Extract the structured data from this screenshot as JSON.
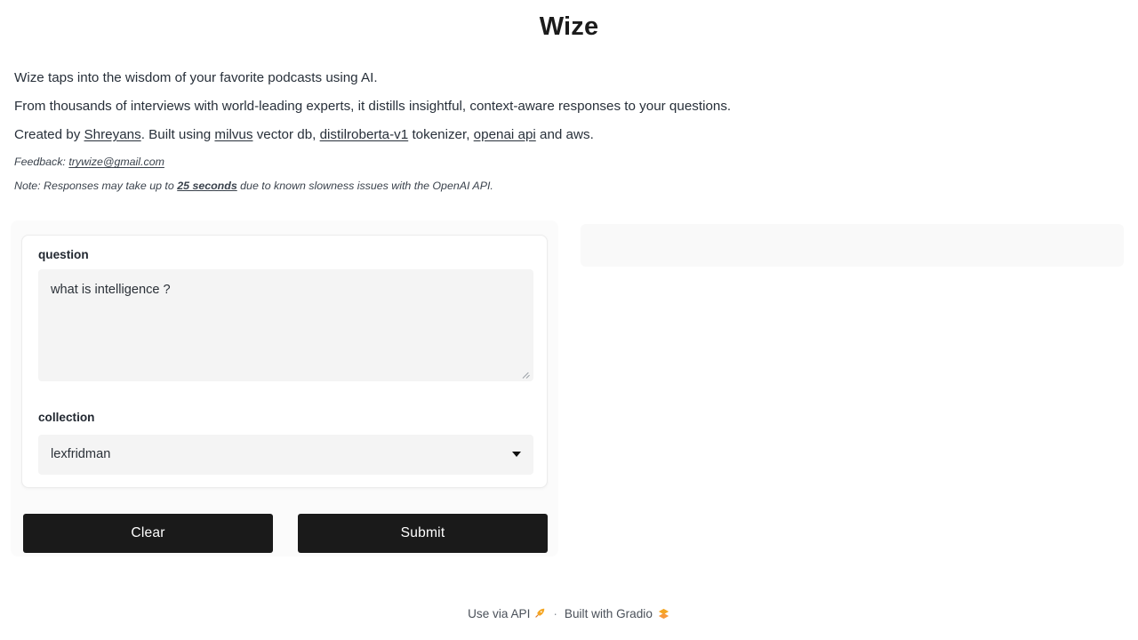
{
  "app": {
    "title": "Wize"
  },
  "description": {
    "line1": "Wize taps into the wisdom of your favorite podcasts using AI.",
    "line2": "From thousands of interviews with world-leading experts, it distills insightful, context-aware responses to your questions.",
    "line3": {
      "prefix": "Created by ",
      "creator_link": "Shreyans",
      "mid1": ". Built using ",
      "vectordb_link": "milvus",
      "mid2": " vector db, ",
      "tokenizer_link": "distilroberta-v1",
      "mid3": " tokenizer, ",
      "openai_link": "openai api",
      "suffix": " and aws."
    },
    "feedback": {
      "label": "Feedback: ",
      "email": "trywize@gmail.com"
    },
    "note": {
      "prefix": "Note: Responses may take up to ",
      "highlight": "25 seconds",
      "suffix": " due to known slowness issues with the OpenAI API."
    }
  },
  "form": {
    "question_label": "question",
    "question_value": "what is intelligence ?",
    "question_placeholder": "",
    "collection_label": "collection",
    "collection_value": "lexfridman",
    "collection_options": [
      "lexfridman"
    ]
  },
  "actions": {
    "clear_label": "Clear",
    "submit_label": "Submit"
  },
  "output": {
    "value": ""
  },
  "footer": {
    "api_label": "Use via API",
    "separator": "·",
    "built_with": "Built with Gradio"
  },
  "colors": {
    "button_bg": "#1a1a1a",
    "button_text": "#ffffff",
    "field_bg": "#f4f4f4",
    "panel_bg": "#fbfbfb",
    "output_bg": "#f9f9f9",
    "accent_orange": "#f5a623"
  }
}
